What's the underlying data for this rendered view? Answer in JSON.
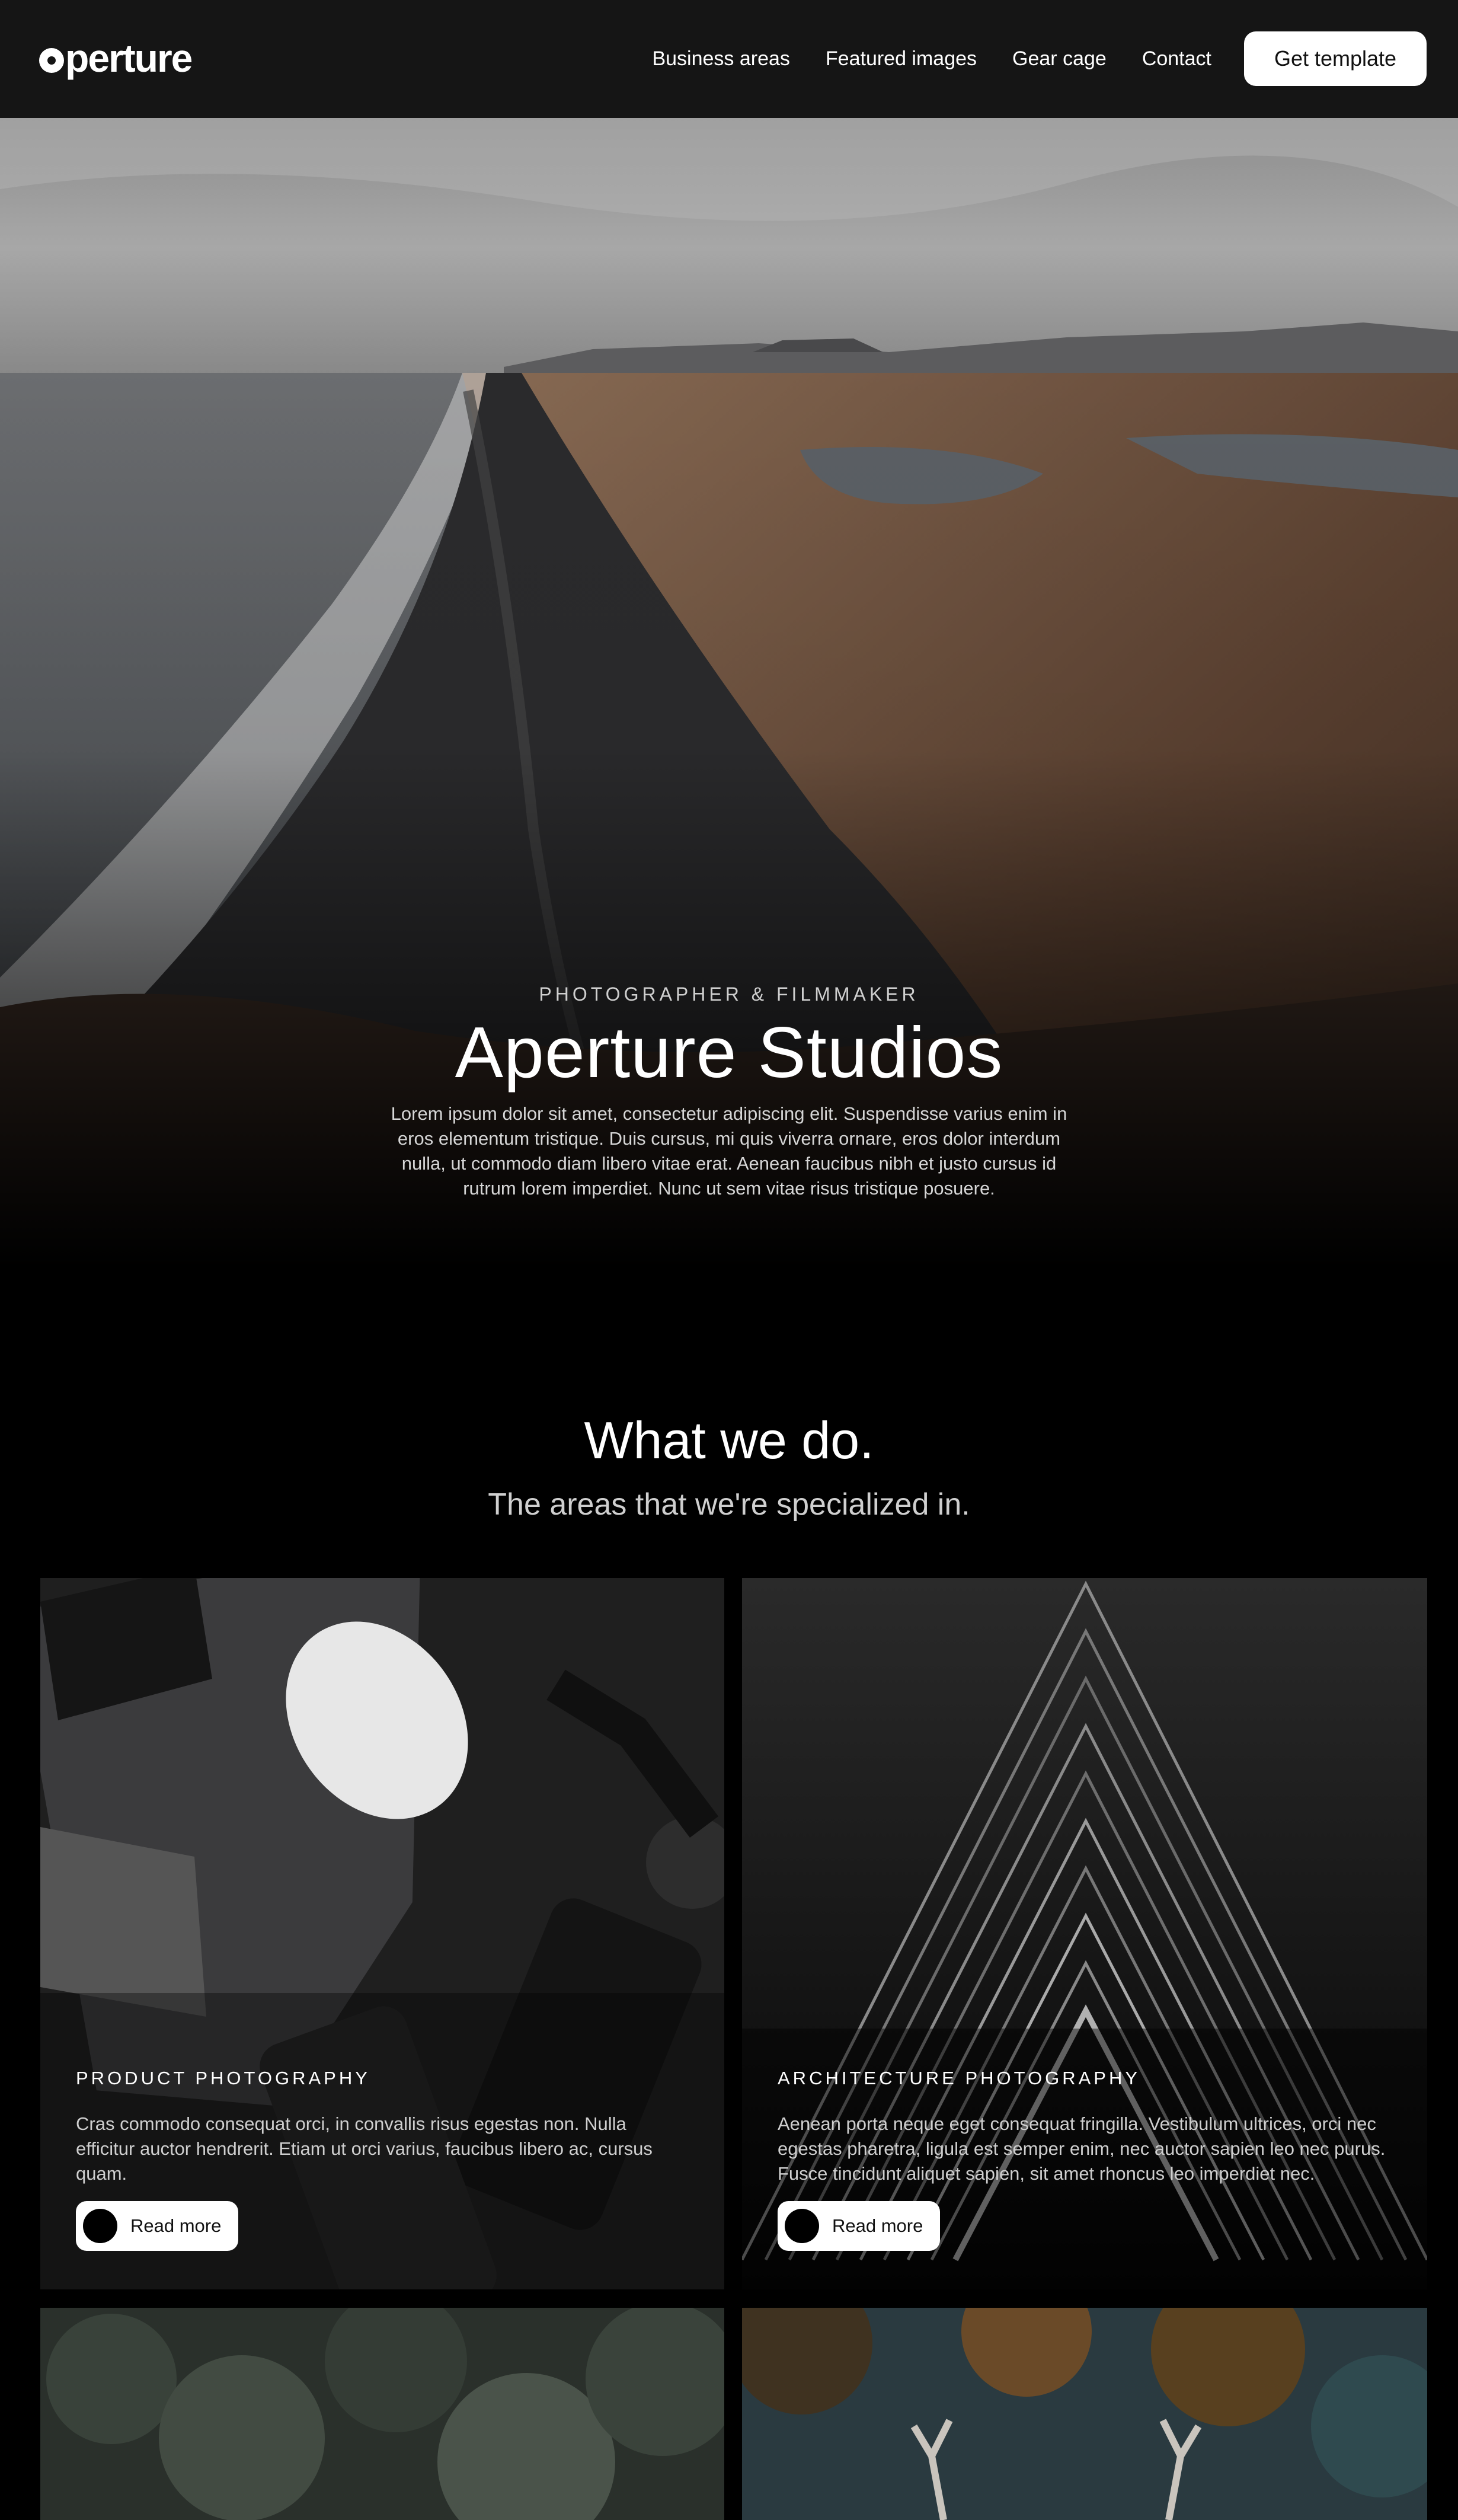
{
  "brand": {
    "logo_text": "perture"
  },
  "nav": {
    "links": [
      "Business areas",
      "Featured images",
      "Gear cage",
      "Contact"
    ],
    "cta_label": "Get template"
  },
  "hero": {
    "eyebrow": "PHOTOGRAPHER & FILMMAKER",
    "title": "Aperture Studios",
    "description": "Lorem ipsum dolor sit amet, consectetur adipiscing elit. Suspendisse varius enim in eros elementum tristique. Duis cursus, mi quis viverra ornare, eros dolor interdum nulla, ut commodo diam libero vitae erat. Aenean faucibus nibh et justo cursus id rutrum lorem imperdiet. Nunc ut sem vitae risus tristique posuere."
  },
  "services": {
    "title": "What we do.",
    "subtitle": "The areas that we're specialized in.",
    "cards": [
      {
        "eyebrow": "PRODUCT PHOTOGRAPHY",
        "description": "Cras commodo consequat orci, in convallis risus egestas non. Nulla efficitur auctor hendrerit. Etiam ut orci varius, faucibus libero ac, cursus quam.",
        "button_label": "Read more"
      },
      {
        "eyebrow": "ARCHITECTURE PHOTOGRAPHY",
        "description": "Aenean porta neque eget consequat fringilla. Vestibulum ultrices, orci nec egestas pharetra, ligula est semper enim, nec auctor sapien leo nec purus. Fusce tincidunt aliquet sapien, sit amet rhoncus leo imperdiet nec.",
        "button_label": "Read more"
      }
    ]
  }
}
